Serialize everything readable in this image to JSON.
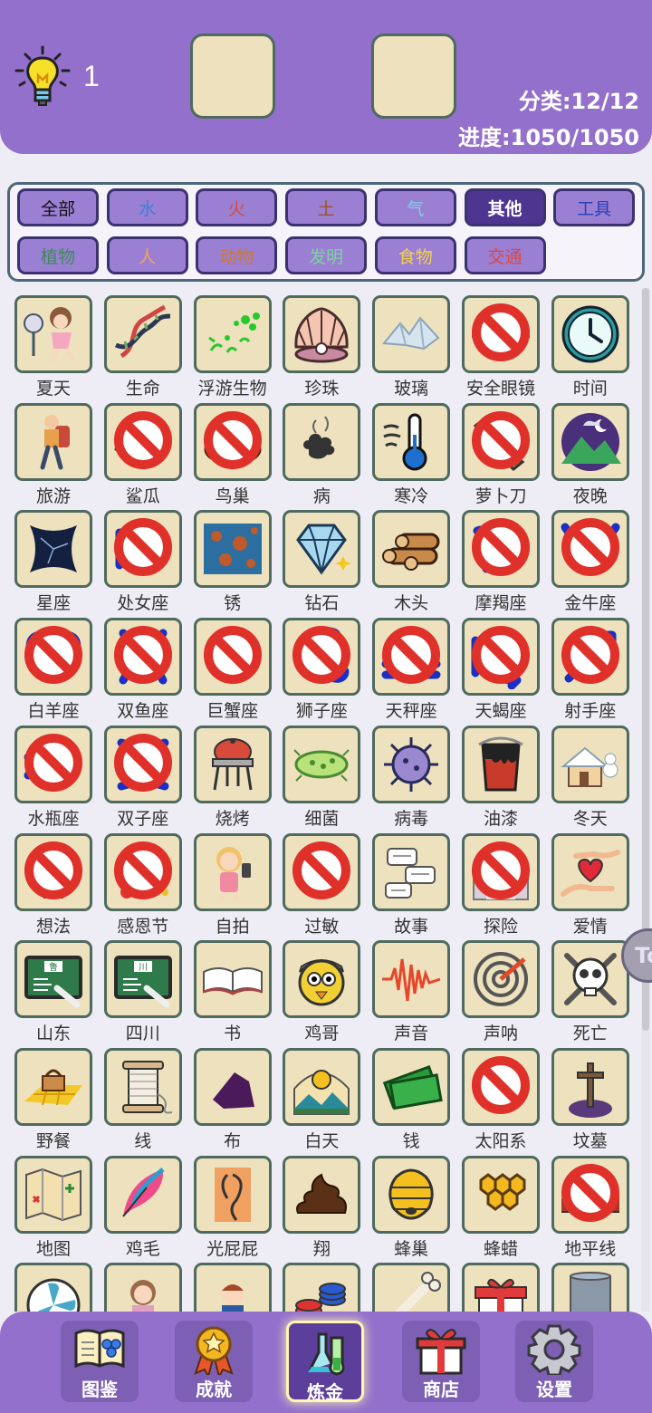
{
  "header": {
    "hint_count": "1",
    "category_stat": "分类:12/12",
    "progress_stat": "进度:1050/1050"
  },
  "filters": [
    {
      "label": "全部",
      "color": "#111111",
      "active": false
    },
    {
      "label": "水",
      "color": "#3b7fd6",
      "active": false
    },
    {
      "label": "火",
      "color": "#d84a3a",
      "active": false
    },
    {
      "label": "土",
      "color": "#a0532a",
      "active": false
    },
    {
      "label": "气",
      "color": "#7fd0e8",
      "active": false
    },
    {
      "label": "其他",
      "color": "#ffffff",
      "active": true
    },
    {
      "label": "工具",
      "color": "#2741b8",
      "active": false
    },
    {
      "label": "植物",
      "color": "#3e8a5c",
      "active": false
    },
    {
      "label": "人",
      "color": "#f3a35c",
      "active": false
    },
    {
      "label": "动物",
      "color": "#d0782e",
      "active": false
    },
    {
      "label": "发明",
      "color": "#7cd3a0",
      "active": false
    },
    {
      "label": "食物",
      "color": "#f3d050",
      "active": false
    },
    {
      "label": "交通",
      "color": "#e0453a",
      "active": false
    }
  ],
  "elements": [
    {
      "name": "夏天",
      "icon": "fan-girl-icon",
      "locked": false
    },
    {
      "name": "生命",
      "icon": "dna-icon",
      "locked": false
    },
    {
      "name": "浮游生物",
      "icon": "plankton-icon",
      "locked": false
    },
    {
      "name": "珍珠",
      "icon": "pearl-shell-icon",
      "locked": false
    },
    {
      "name": "玻璃",
      "icon": "glass-shards-icon",
      "locked": false
    },
    {
      "name": "安全眼镜",
      "icon": "safety-goggles-icon",
      "locked": true
    },
    {
      "name": "时间",
      "icon": "clock-icon",
      "locked": false
    },
    {
      "name": "旅游",
      "icon": "traveler-icon",
      "locked": false
    },
    {
      "name": "鲨瓜",
      "icon": "shark-melon-icon",
      "locked": true
    },
    {
      "name": "鸟巢",
      "icon": "bird-nest-icon",
      "locked": true
    },
    {
      "name": "病",
      "icon": "sickness-icon",
      "locked": false
    },
    {
      "name": "寒冷",
      "icon": "thermometer-cold-icon",
      "locked": false
    },
    {
      "name": "萝卜刀",
      "icon": "radish-knife-icon",
      "locked": true
    },
    {
      "name": "夜晚",
      "icon": "night-mountain-icon",
      "locked": false
    },
    {
      "name": "星座",
      "icon": "constellation-icon",
      "locked": false
    },
    {
      "name": "处女座",
      "icon": "virgo-icon",
      "locked": true
    },
    {
      "name": "锈",
      "icon": "rust-icon",
      "locked": false
    },
    {
      "name": "钻石",
      "icon": "diamond-icon",
      "locked": false
    },
    {
      "name": "木头",
      "icon": "wood-logs-icon",
      "locked": false
    },
    {
      "name": "摩羯座",
      "icon": "capricorn-icon",
      "locked": true
    },
    {
      "name": "金牛座",
      "icon": "taurus-icon",
      "locked": true
    },
    {
      "name": "白羊座",
      "icon": "aries-icon",
      "locked": true
    },
    {
      "name": "双鱼座",
      "icon": "pisces-icon",
      "locked": true
    },
    {
      "name": "巨蟹座",
      "icon": "cancer-icon",
      "locked": true
    },
    {
      "name": "狮子座",
      "icon": "leo-icon",
      "locked": true
    },
    {
      "name": "天秤座",
      "icon": "libra-icon",
      "locked": true
    },
    {
      "name": "天蝎座",
      "icon": "scorpio-icon",
      "locked": true
    },
    {
      "name": "射手座",
      "icon": "sagittarius-icon",
      "locked": true
    },
    {
      "name": "水瓶座",
      "icon": "aquarius-icon",
      "locked": true
    },
    {
      "name": "双子座",
      "icon": "gemini-icon",
      "locked": true
    },
    {
      "name": "烧烤",
      "icon": "barbecue-grill-icon",
      "locked": false
    },
    {
      "name": "细菌",
      "icon": "bacteria-icon",
      "locked": false
    },
    {
      "name": "病毒",
      "icon": "virus-icon",
      "locked": false
    },
    {
      "name": "油漆",
      "icon": "paint-bucket-icon",
      "locked": false
    },
    {
      "name": "冬天",
      "icon": "winter-house-icon",
      "locked": false
    },
    {
      "name": "想法",
      "icon": "idea-bulb-icon",
      "locked": true
    },
    {
      "name": "感恩节",
      "icon": "roast-turkey-icon",
      "locked": true
    },
    {
      "name": "自拍",
      "icon": "selfie-girl-icon",
      "locked": false
    },
    {
      "name": "过敏",
      "icon": "allergy-cloud-icon",
      "locked": true
    },
    {
      "name": "故事",
      "icon": "speech-bubbles-icon",
      "locked": false
    },
    {
      "name": "探险",
      "icon": "explorer-cave-icon",
      "locked": true
    },
    {
      "name": "爱情",
      "icon": "heart-hands-icon",
      "locked": false
    },
    {
      "name": "山东",
      "icon": "chalkboard-shandong-icon",
      "locked": false,
      "sign": "鲁"
    },
    {
      "name": "四川",
      "icon": "chalkboard-sichuan-icon",
      "locked": false,
      "sign": "川"
    },
    {
      "name": "书",
      "icon": "open-book-icon",
      "locked": false
    },
    {
      "name": "鸡哥",
      "icon": "chicken-face-icon",
      "locked": false
    },
    {
      "name": "声音",
      "icon": "sound-wave-icon",
      "locked": false
    },
    {
      "name": "声呐",
      "icon": "sonar-icon",
      "locked": false
    },
    {
      "name": "死亡",
      "icon": "skull-crossbones-icon",
      "locked": false
    },
    {
      "name": "野餐",
      "icon": "picnic-basket-icon",
      "locked": false
    },
    {
      "name": "线",
      "icon": "thread-spool-icon",
      "locked": false
    },
    {
      "name": "布",
      "icon": "cloth-icon",
      "locked": false
    },
    {
      "name": "白天",
      "icon": "sun-day-icon",
      "locked": false
    },
    {
      "name": "钱",
      "icon": "money-icon",
      "locked": false
    },
    {
      "name": "太阳系",
      "icon": "solar-system-icon",
      "locked": true
    },
    {
      "name": "坟墓",
      "icon": "grave-cross-icon",
      "locked": false
    },
    {
      "name": "地图",
      "icon": "map-icon",
      "locked": false
    },
    {
      "name": "鸡毛",
      "icon": "feather-icon",
      "locked": false
    },
    {
      "name": "光屁屁",
      "icon": "bare-bottom-icon",
      "locked": false
    },
    {
      "name": "翔",
      "icon": "poop-icon",
      "locked": false
    },
    {
      "name": "蜂巢",
      "icon": "beehive-icon",
      "locked": false
    },
    {
      "name": "蜂蜡",
      "icon": "honeycomb-icon",
      "locked": false
    },
    {
      "name": "地平线",
      "icon": "skyline-icon",
      "locked": true
    },
    {
      "name": "",
      "icon": "fan-icon",
      "locked": false
    },
    {
      "name": "",
      "icon": "girl-icon",
      "locked": false
    },
    {
      "name": "",
      "icon": "boy-icon",
      "locked": false
    },
    {
      "name": "",
      "icon": "poker-chips-icon",
      "locked": false
    },
    {
      "name": "",
      "icon": "bone-icon",
      "locked": false
    },
    {
      "name": "",
      "icon": "gift-box-icon",
      "locked": false
    },
    {
      "name": "",
      "icon": "scroll-icon",
      "locked": false
    }
  ],
  "side_button": {
    "text": "To"
  },
  "nav": [
    {
      "label": "图鉴",
      "icon": "encyclopedia-book-icon",
      "active": false
    },
    {
      "label": "成就",
      "icon": "achievement-medal-icon",
      "active": false
    },
    {
      "label": "炼金",
      "icon": "alchemy-flask-icon",
      "active": true
    },
    {
      "label": "商店",
      "icon": "shop-gift-icon",
      "active": false
    },
    {
      "label": "设置",
      "icon": "settings-gear-icon",
      "active": false
    }
  ]
}
